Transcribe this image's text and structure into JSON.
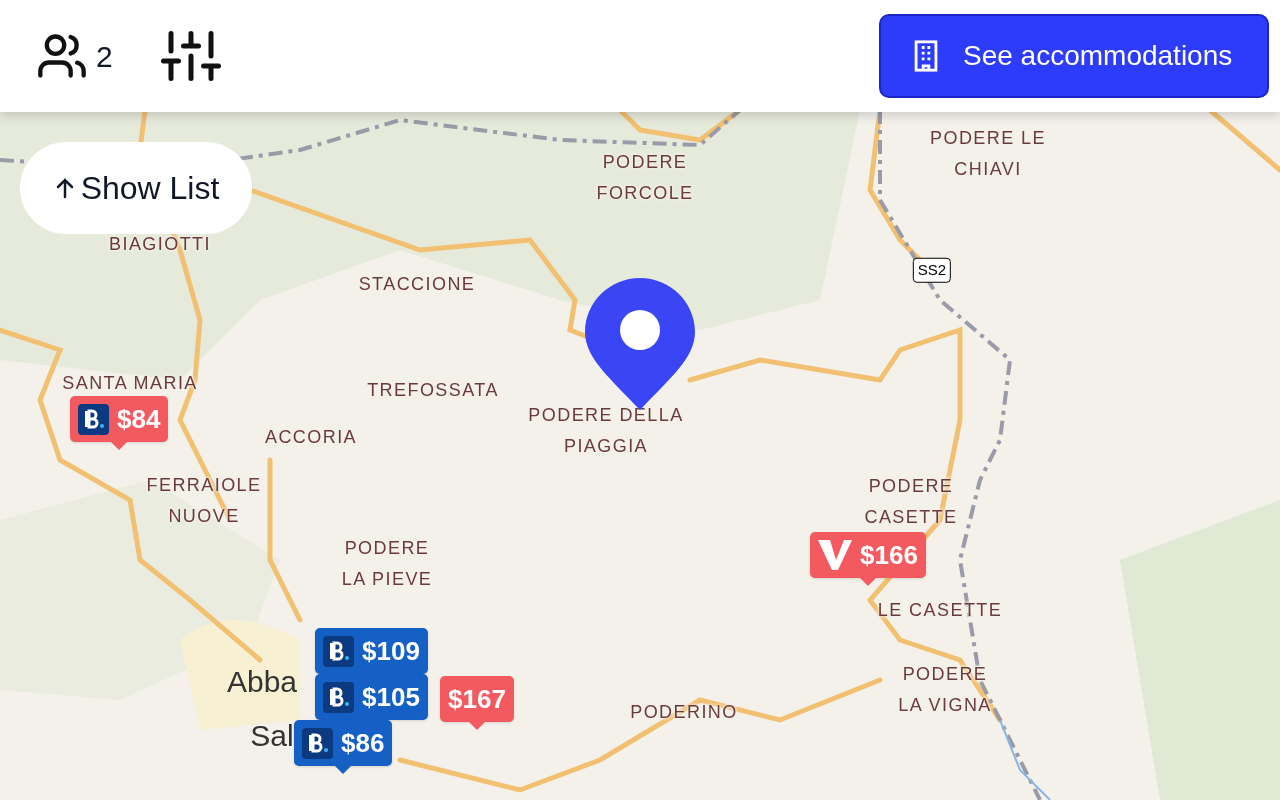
{
  "header": {
    "guests": "2",
    "cta": "See accommodations"
  },
  "show_list": "Show List",
  "map_labels": [
    {
      "kind": "place",
      "text": "PODERE FORCOLE"
    },
    {
      "kind": "place",
      "text": "PODERE LE CHIAVI"
    },
    {
      "kind": "place",
      "text": "BIAGIOTTI"
    },
    {
      "kind": "place",
      "text": "STACCIONE"
    },
    {
      "kind": "place",
      "text": "SANTA MARIA"
    },
    {
      "kind": "place",
      "text": "TREFOSSATA"
    },
    {
      "kind": "place",
      "text": "ACCORIA"
    },
    {
      "kind": "place",
      "text": "PODERE DELLA PIAGGIA"
    },
    {
      "kind": "place",
      "text": "FERRAIOLE NUOVE"
    },
    {
      "kind": "place",
      "text": "PODERE CASETTE"
    },
    {
      "kind": "place",
      "text": "LE CASETTE"
    },
    {
      "kind": "place",
      "text": "PODERE LA PIEVE"
    },
    {
      "kind": "place",
      "text": "PODERE LA VIGNA"
    },
    {
      "kind": "place",
      "text": "PODERINO"
    },
    {
      "kind": "road",
      "text": "SS2"
    },
    {
      "kind": "town",
      "text": "Abba"
    },
    {
      "kind": "town",
      "text": "Sal"
    }
  ],
  "markers": [
    {
      "kind": "booking",
      "price": "$84",
      "color": "#f25a5f"
    },
    {
      "kind": "vrbo",
      "price": "$166",
      "color": "#f25a5f"
    },
    {
      "kind": "none",
      "price": "$167",
      "color": "#f25a5f"
    },
    {
      "kind": "booking",
      "price": "$109",
      "color": "#1560c4"
    },
    {
      "kind": "booking",
      "price": "$105",
      "color": "#1560c4"
    },
    {
      "kind": "booking",
      "price": "$86",
      "color": "#1560c4"
    }
  ]
}
